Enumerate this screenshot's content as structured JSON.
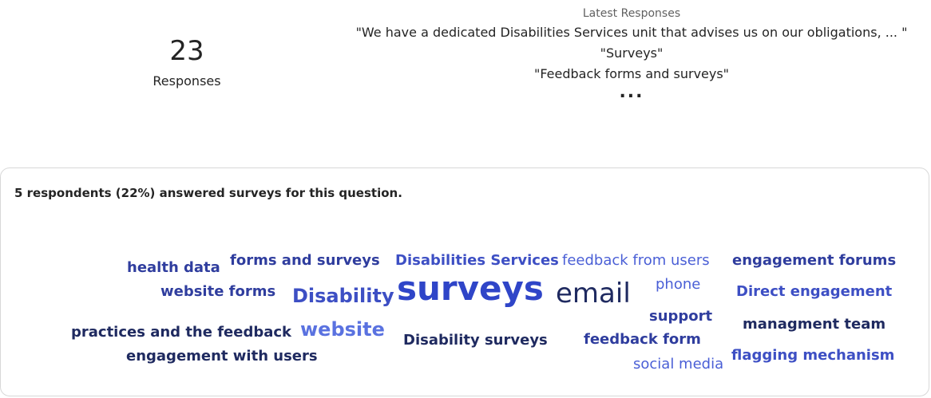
{
  "summary": {
    "count": "23",
    "label": "Responses"
  },
  "latest": {
    "title": "Latest Responses",
    "items": [
      "\"We have a dedicated Disabilities Services unit that advises us on our obligations, ... \"",
      "\"Surveys\"",
      "\"Feedback forms and surveys\""
    ],
    "more": "..."
  },
  "card": {
    "answered_text": "5 respondents (22%) answered surveys for this question."
  },
  "colors": {
    "dark": "#1f2a60",
    "mid": "#2f3d9e",
    "accent": "#4a5fd6",
    "light": "#5a72e0"
  },
  "word_cloud": [
    {
      "text": "health data"
    },
    {
      "text": "forms and surveys"
    },
    {
      "text": "Disabilities Services"
    },
    {
      "text": "feedback from users"
    },
    {
      "text": "engagement forums"
    },
    {
      "text": "website forms"
    },
    {
      "text": "Disability"
    },
    {
      "text": "surveys"
    },
    {
      "text": "email"
    },
    {
      "text": "phone"
    },
    {
      "text": "Direct engagement"
    },
    {
      "text": "support"
    },
    {
      "text": "practices and the feedback"
    },
    {
      "text": "website"
    },
    {
      "text": "managment team"
    },
    {
      "text": "Disability surveys"
    },
    {
      "text": "feedback form"
    },
    {
      "text": "engagement with users"
    },
    {
      "text": "social media"
    },
    {
      "text": "flagging mechanism"
    }
  ]
}
